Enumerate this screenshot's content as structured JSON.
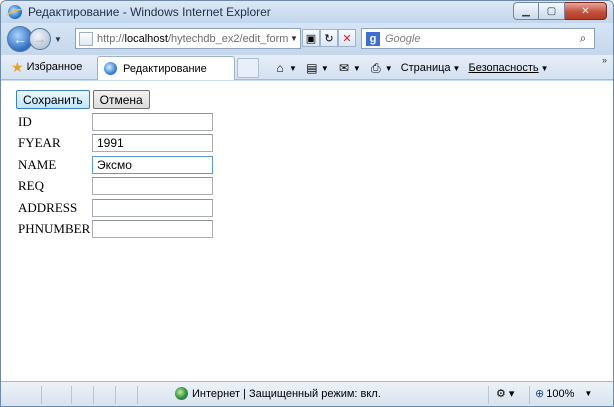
{
  "window": {
    "title": "Редактирование - Windows Internet Explorer"
  },
  "navbar": {
    "url_prefix": "http://",
    "url_host": "localhost",
    "url_path": "/hytechdb_ex2/edit_form.p",
    "search_placeholder": "Google"
  },
  "tabbar": {
    "favorites_label": "Избранное",
    "tab_title": "Редактирование",
    "page_menu": "Страница",
    "safety_menu": "Безопасность"
  },
  "form": {
    "save_label": "Сохранить",
    "cancel_label": "Отмена",
    "fields": [
      {
        "label": "ID",
        "value": ""
      },
      {
        "label": "FYEAR",
        "value": "1991"
      },
      {
        "label": "NAME",
        "value": "Эксмо"
      },
      {
        "label": "REQ",
        "value": ""
      },
      {
        "label": "ADDRESS",
        "value": ""
      },
      {
        "label": "PHNUMBER",
        "value": ""
      }
    ]
  },
  "status": {
    "zone_text": "Интернет | Защищенный режим: вкл.",
    "zoom": "100%"
  }
}
